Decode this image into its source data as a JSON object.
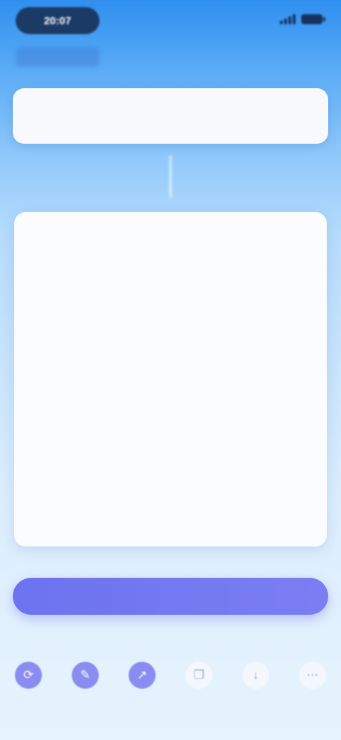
{
  "status_bar": {
    "time": "20:07"
  },
  "title_card": {
    "title": "",
    "subtitle": ""
  },
  "content_card": {
    "heading": "",
    "lines": []
  },
  "primary_button": {
    "label": ""
  },
  "hint": {
    "text": ""
  },
  "actions": [
    {
      "icon": "refresh-icon",
      "label": ""
    },
    {
      "icon": "edit-icon",
      "label": ""
    },
    {
      "icon": "share-icon",
      "label": ""
    },
    {
      "icon": "copy-icon",
      "label": ""
    },
    {
      "icon": "download-icon",
      "label": ""
    },
    {
      "icon": "more-icon",
      "label": ""
    }
  ],
  "colors": {
    "accent": "#6d73f0",
    "card": "#fbfcfe",
    "sky_top": "#2f8ff0",
    "sky_bottom": "#e7f3fe"
  }
}
